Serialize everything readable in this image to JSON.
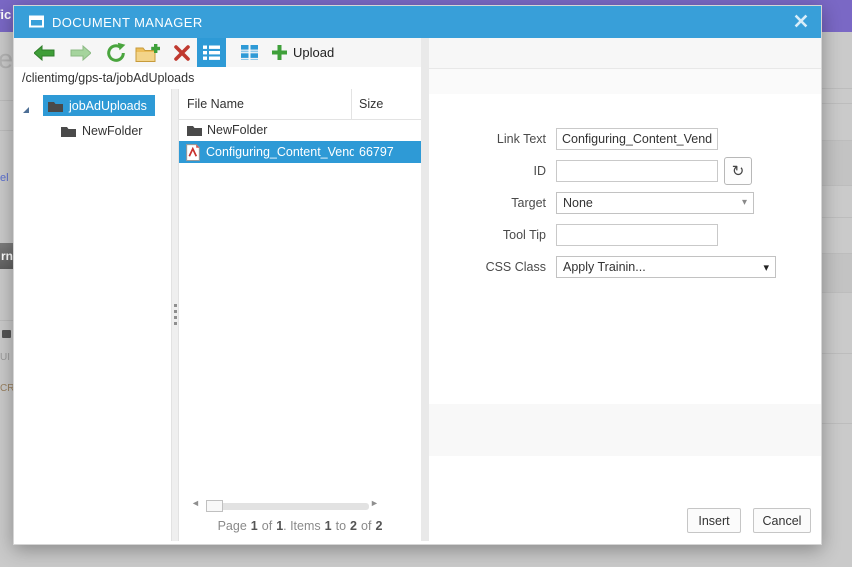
{
  "backdrop": {
    "top_text": "fic",
    "frag_re": "re",
    "frag_el": "el",
    "frag_rn": "rn",
    "frag_ui": "UI",
    "frag_cri": "CRI"
  },
  "dialog": {
    "title": "DOCUMENT MANAGER"
  },
  "toolbar": {
    "upload_label": "Upload",
    "icons": {
      "back": "arrow-left",
      "forward": "arrow-right",
      "refresh": "refresh-circular-arrows",
      "new_folder": "folder-plus",
      "delete": "red-x",
      "list_view": "list-view",
      "grid_view": "thumbnails-view",
      "upload": "green-plus"
    }
  },
  "path_bar": {
    "path": "/clientimg/gps-ta/jobAdUploads"
  },
  "tree": {
    "items": [
      {
        "label": "jobAdUploads",
        "selected": true
      },
      {
        "label": "NewFolder",
        "selected": false
      }
    ]
  },
  "files": {
    "columns": {
      "name": "File Name",
      "size": "Size"
    },
    "rows": [
      {
        "name": "NewFolder",
        "size": "",
        "type": "folder",
        "selected": false
      },
      {
        "name": "Configuring_Content_Vendo",
        "size": "66797",
        "type": "pdf",
        "selected": true
      }
    ],
    "pager": {
      "t1": "Page",
      "n1": "1",
      "t2": "of",
      "n2": "1",
      "t3": ". Items",
      "n3": "1",
      "t4": "to",
      "n4": "2",
      "t5": "of",
      "n5": "2"
    }
  },
  "form": {
    "link_text": {
      "label": "Link Text",
      "value": "Configuring_Content_Vendor"
    },
    "id_field": {
      "label": "ID",
      "value": ""
    },
    "target": {
      "label": "Target",
      "value": "None"
    },
    "tool_tip": {
      "label": "Tool Tip",
      "value": ""
    },
    "css_class": {
      "label": "CSS Class",
      "value": "Apply Trainin..."
    }
  },
  "footer": {
    "insert": "Insert",
    "cancel": "Cancel"
  },
  "glyphs": {
    "id_refresh": "↻",
    "dropdown_arrow": "▾",
    "pager_prev": "◄",
    "pager_next": "►"
  },
  "colors": {
    "titlebar_blue": "#389fd9",
    "selection_blue": "#2e9ad6",
    "backdrop_purple": "#7a68c5",
    "toolbar_green": "#3fa03a",
    "delete_red": "#c0392f",
    "folder_yellow": "#ecbe5a"
  }
}
